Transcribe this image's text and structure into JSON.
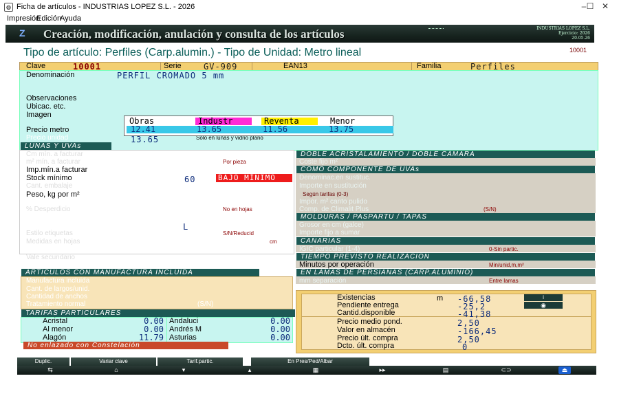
{
  "window": {
    "title": "Ficha de artículos - INDUSTRIAS LOPEZ S.L. - 2026",
    "minimize": "–",
    "maximize": "☐",
    "close": "✕"
  },
  "menu": [
    "Impresión",
    "Edición",
    "Ayuda"
  ],
  "banner": {
    "title": "Creación, modificación, anulación y consulta de los artículos",
    "company": "INDUSTRIAS LOPEZ S.L.",
    "exercise": "Ejercicio: 2026",
    "date": "20.05.26"
  },
  "heading": "Tipo de artículo: Perfiles (Carp.alumin.)  -  Tipo de Unidad: Metro lineal",
  "record_code": "10001",
  "header": {
    "clave_label": "Clave",
    "clave_value": "10001",
    "serie_label": "Serie",
    "serie_value": "GV-909",
    "ean_label": "EAN13",
    "familia_label": "Familia",
    "familia_value": "Perfiles"
  },
  "main": {
    "denominacion_label": "Denominación",
    "denominacion_value": "PERFIL CROMADO 5 mm",
    "observaciones_label": "Observaciones",
    "ubicac_label": "Ubicac. etc.",
    "imagen_label": "Imagen",
    "precio_label": "Precio metro",
    "precio_unit_label": "Precio unidad",
    "precio_unit_value": "13.65",
    "solo_lunas": "Solo en lunas y vidrio plano"
  },
  "prices": {
    "headers": [
      "Obras",
      "Industr",
      "Reventa",
      "Menor"
    ],
    "values": [
      "12.41",
      "13.65",
      "11.56",
      "13.75"
    ]
  },
  "lunas": {
    "title": "LUNAS Y UVAs",
    "min_unid": "Cm mín. a facturar",
    "min_unid2": "m² mín. a facturar",
    "por_pieza": "Por pieza",
    "imp_min": "Imp.mín.a facturar",
    "stock_min": "Stock mínimo",
    "stock_value": "60",
    "bajo_minimo": "BAJO MÍNIMO",
    "cant_embalaje": "Cant. embalaje",
    "peso": "Peso, kg por m²",
    "desperdicio": "% Desperdicio",
    "no_en_hojas": "No en hojas",
    "unidad_l": "L",
    "estilo": "Estilo etiquetas",
    "sn_reducid": "S/N/Reducid",
    "medidas": "Medidas en hojas",
    "cm": "cm",
    "vale_secundario": "Vale secundario"
  },
  "doble": {
    "title": "DOBLE ACRISTALAMIENTO / DOBLE CÁMARA",
    "coste": "Coste fijo m²"
  },
  "uvas": {
    "title": "COMO COMPONENTE DE UVAs",
    "denominac": "Denominac.en sustituc.",
    "importe": "Importe en sustitución",
    "segun": "Según tarifas (0-3)",
    "impor": "Impor. m² canto pulido",
    "comp": "Comp. de Climalit Plus",
    "sn": "(S/N)"
  },
  "molduras": {
    "title": "MOLDURAS / PASPARTU / TAPAS",
    "grosor": "Grosor en cm (galce)",
    "importe": "Importe fijo a sumar"
  },
  "canarias": {
    "title": "CANARIAS",
    "igic": "IGIC particular (1-4)",
    "sin_partic": "0-Sin partic."
  },
  "tiempo": {
    "title": "TIEMPO PREVISTO REALIZACION",
    "minutos": "Minutos por operación",
    "unidades": "Min/unid,m,m²"
  },
  "persianas": {
    "title": "EN LAMAS DE PERSIANAS (CARP.ALUMINIO)",
    "mm": "mm separación",
    "entre": "Entre lamas"
  },
  "manufactura": {
    "title": "ARTICULOS CON MANUFACTURA INCLUIDA",
    "incluida": "Manufactura incluida",
    "largos": "Cant. de largos/unid.",
    "anchos": "Cantidad de anchos",
    "tratamiento": "Tratamiento normal",
    "sn": "(S/N)"
  },
  "tarifas": {
    "title": "TARIFAS PARTICULARES",
    "left": [
      {
        "label": "Acristal",
        "value": "0.00"
      },
      {
        "label": "Al menor",
        "value": "0.00"
      },
      {
        "label": "Alagón",
        "value": "11.79"
      }
    ],
    "right": [
      {
        "label": "Andaluci",
        "value": "0.00"
      },
      {
        "label": "Andrés M",
        "value": "0.00"
      },
      {
        "label": "Asturias",
        "value": "0.00"
      }
    ]
  },
  "constelacion": "No enlazado con Constelación",
  "stock": {
    "rows": [
      {
        "label": "Existencias",
        "unit": "m",
        "value": "-66,58"
      },
      {
        "label": "Pendiente entrega",
        "unit": "",
        "value": "-25,2"
      },
      {
        "label": "Cantid.disponible",
        "unit": "",
        "value": "-41,38"
      },
      {
        "label": "Precio medio pond.",
        "unit": "",
        "value": "2,50"
      },
      {
        "label": "Valor en almacén",
        "unit": "",
        "value": "-166,45"
      },
      {
        "label": "Precio últ. compra",
        "unit": "",
        "value": "2,50"
      },
      {
        "label": "Dcto. últ. compra",
        "unit": "",
        "value": "0"
      }
    ]
  },
  "toolbar": {
    "duplic": "Duplic.",
    "variar": "Variar clave",
    "tarif": "Tarif.partic.",
    "pres": "En Pres/Ped/Albar"
  }
}
